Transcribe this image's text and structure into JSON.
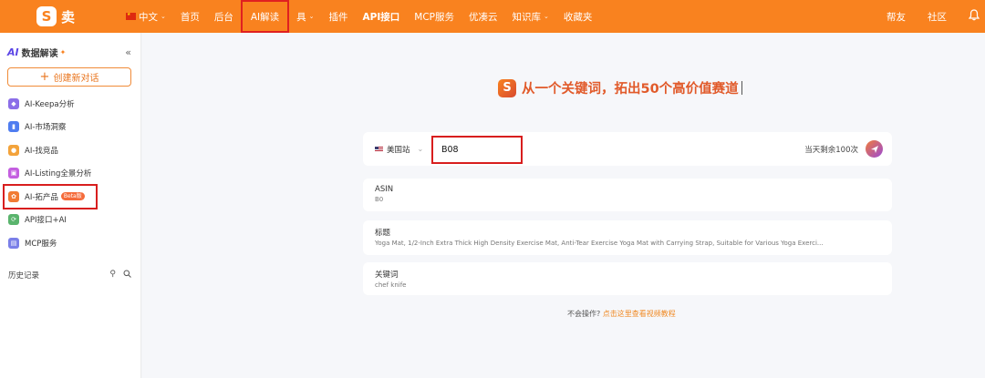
{
  "topbar": {
    "logo_mark": "S",
    "logo_text": "卖",
    "nav": [
      {
        "label": "中文",
        "caret": "⌄"
      },
      {
        "label": "首页"
      },
      {
        "label": "后台"
      },
      {
        "label": "AI解读"
      },
      {
        "label": "具",
        "caret": "⌄"
      },
      {
        "label": "插件"
      },
      {
        "label": "API接口"
      },
      {
        "label": "MCP服务"
      },
      {
        "label": "优凑云"
      },
      {
        "label": "知识库",
        "caret": "⌄"
      },
      {
        "label": "收藏夹"
      }
    ],
    "right": {
      "item1": "帮友",
      "item2": "社区"
    }
  },
  "sidebar": {
    "ai_badge": "AI",
    "title": "数据解读",
    "new_chat": "创建新对话",
    "items": [
      {
        "label": "AI-Keepa分析",
        "color": "#8b6ee8"
      },
      {
        "label": "AI-市场洞察",
        "color": "#4f7df0"
      },
      {
        "label": "AI-找竞品",
        "color": "#f3a33b"
      },
      {
        "label": "AI-Listing全景分析",
        "color": "#c45fe0"
      },
      {
        "label": "AI-拓产品",
        "color": "#f17b33",
        "badge": "Beta版"
      },
      {
        "label": "API接口+AI",
        "color": "#5ab46d"
      },
      {
        "label": "MCP服务",
        "color": "#7a7fe8"
      }
    ],
    "history": "历史记录"
  },
  "main": {
    "slogan": "从一个关键词，拓出50个高价值赛道",
    "search": {
      "site": "美国站",
      "value": "B08",
      "quota": "当天剩余100次"
    },
    "suggestions": [
      {
        "label": "ASIN",
        "value": "B0"
      },
      {
        "label": "标题",
        "value": "Yoga Mat, 1/2-Inch Extra Thick High Density Exercise Mat, Anti-Tear Exercise Yoga Mat with Carrying Strap, Suitable for Various Yoga Exerci..."
      },
      {
        "label": "关键词",
        "value": "chef knife"
      }
    ],
    "help_prefix": "不会操作?",
    "help_link": "点击这里查看视频教程"
  }
}
